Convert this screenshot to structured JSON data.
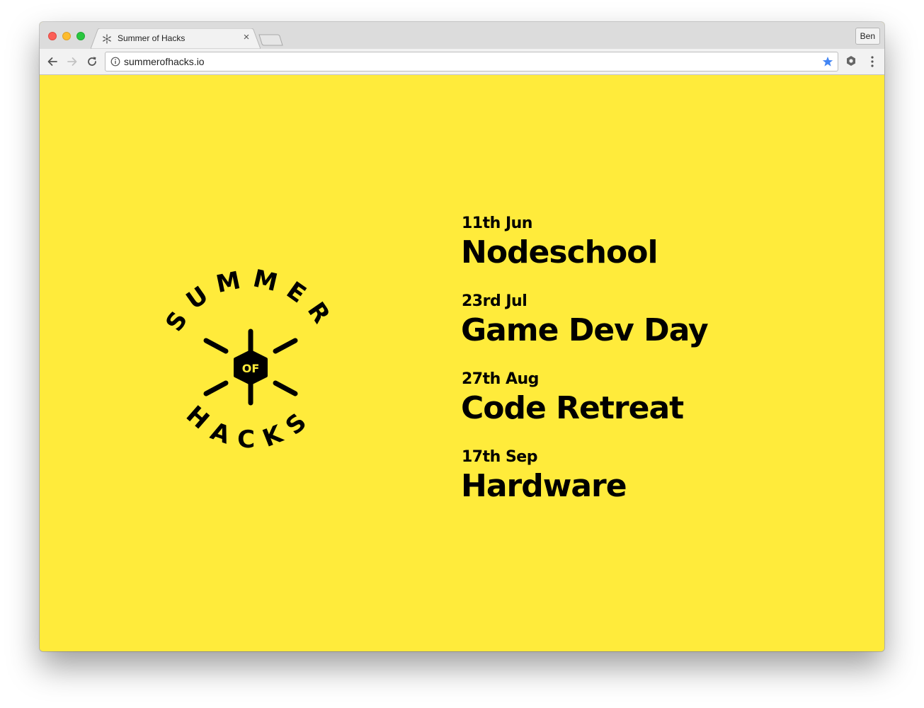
{
  "browser": {
    "tab": {
      "title": "Summer of Hacks",
      "favicon": "sun-icon",
      "close_label": "×"
    },
    "profile_label": "Ben",
    "address_bar": {
      "url": "summerofhacks.io",
      "security_icon": "info-icon",
      "bookmark_icon": "star-icon"
    },
    "toolbar_icons": [
      "back-arrow-icon",
      "forward-arrow-icon",
      "reload-icon",
      "extension-icon",
      "menu-icon"
    ]
  },
  "page": {
    "background_color": "#ffeb3b",
    "logo": {
      "top_text": "SUMMER",
      "center_text": "OF",
      "bottom_text": "HACKS"
    },
    "events": [
      {
        "date": "11th Jun",
        "name": "Nodeschool"
      },
      {
        "date": "23rd Jul",
        "name": "Game Dev Day"
      },
      {
        "date": "27th Aug",
        "name": "Code Retreat"
      },
      {
        "date": "17th Sep",
        "name": "Hardware"
      }
    ]
  }
}
